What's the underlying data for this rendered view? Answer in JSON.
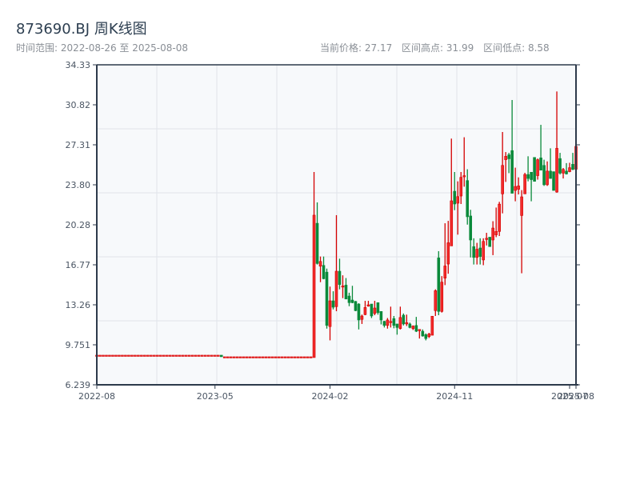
{
  "header": {
    "title": "873690.BJ 周K线图",
    "range_label": "时间范围: 2022-08-26 至 2025-08-08",
    "current_price": "当前价格: 27.17",
    "range_high": "区间高点: 31.99",
    "range_low": "区间低点: 8.58"
  },
  "colors": {
    "up": "#d40000",
    "up_fill": "#f22a2a",
    "down": "#0a8a3a",
    "axis": "#2d3a4b",
    "grid": "#e1e4ea",
    "plot_bg": "#f7f9fb"
  },
  "chart_data": {
    "type": "candlestick",
    "title": "873690.BJ 周K线图",
    "ylim": [
      6.239,
      34.33
    ],
    "yticks": [
      "6.239",
      "9.751",
      "13.26",
      "16.77",
      "20.28",
      "23.80",
      "27.31",
      "30.82",
      "34.33"
    ],
    "xticks": [
      {
        "label": "2022-08",
        "date": "2022-08-26"
      },
      {
        "label": "2023-05",
        "date": "2023-05-12"
      },
      {
        "label": "2024-02",
        "date": "2024-02-16"
      },
      {
        "label": "2024-11",
        "date": "2024-11-15"
      },
      {
        "label": "2025-07",
        "date": "2025-07-25"
      },
      {
        "label": "2025-08",
        "date": "2025-08-08"
      }
    ],
    "grid": true,
    "fields": [
      "date",
      "open",
      "close",
      "low",
      "high"
    ],
    "candles": [
      [
        "2022-08-26",
        8.84,
        8.84,
        8.84,
        8.84
      ],
      [
        "2022-09-02",
        8.84,
        8.84,
        8.84,
        8.84
      ],
      [
        "2022-09-09",
        8.84,
        8.84,
        8.84,
        8.84
      ],
      [
        "2022-09-16",
        8.84,
        8.84,
        8.84,
        8.84
      ],
      [
        "2022-09-23",
        8.84,
        8.84,
        8.84,
        8.84
      ],
      [
        "2022-09-30",
        8.84,
        8.84,
        8.84,
        8.84
      ],
      [
        "2022-10-07",
        8.84,
        8.84,
        8.84,
        8.84
      ],
      [
        "2022-10-14",
        8.84,
        8.84,
        8.84,
        8.84
      ],
      [
        "2022-10-21",
        8.84,
        8.84,
        8.84,
        8.84
      ],
      [
        "2022-10-28",
        8.84,
        8.84,
        8.84,
        8.84
      ],
      [
        "2022-11-04",
        8.84,
        8.84,
        8.84,
        8.84
      ],
      [
        "2022-11-11",
        8.84,
        8.84,
        8.84,
        8.84
      ],
      [
        "2022-11-18",
        8.84,
        8.84,
        8.84,
        8.84
      ],
      [
        "2022-11-25",
        8.84,
        8.84,
        8.84,
        8.84
      ],
      [
        "2022-12-02",
        8.84,
        8.84,
        8.84,
        8.84
      ],
      [
        "2022-12-09",
        8.84,
        8.84,
        8.84,
        8.84
      ],
      [
        "2022-12-16",
        8.84,
        8.84,
        8.84,
        8.84
      ],
      [
        "2022-12-23",
        8.84,
        8.84,
        8.84,
        8.84
      ],
      [
        "2022-12-30",
        8.84,
        8.84,
        8.84,
        8.84
      ],
      [
        "2023-01-06",
        8.84,
        8.84,
        8.84,
        8.84
      ],
      [
        "2023-01-13",
        8.84,
        8.84,
        8.84,
        8.84
      ],
      [
        "2023-01-20",
        8.84,
        8.84,
        8.84,
        8.84
      ],
      [
        "2023-01-27",
        8.84,
        8.84,
        8.84,
        8.84
      ],
      [
        "2023-02-03",
        8.84,
        8.84,
        8.84,
        8.84
      ],
      [
        "2023-02-10",
        8.84,
        8.84,
        8.84,
        8.84
      ],
      [
        "2023-02-17",
        8.84,
        8.84,
        8.84,
        8.84
      ],
      [
        "2023-02-24",
        8.84,
        8.84,
        8.84,
        8.84
      ],
      [
        "2023-03-03",
        8.84,
        8.84,
        8.84,
        8.84
      ],
      [
        "2023-03-10",
        8.84,
        8.84,
        8.84,
        8.84
      ],
      [
        "2023-03-17",
        8.84,
        8.84,
        8.84,
        8.84
      ],
      [
        "2023-03-24",
        8.84,
        8.84,
        8.84,
        8.84
      ],
      [
        "2023-03-31",
        8.84,
        8.84,
        8.84,
        8.84
      ],
      [
        "2023-04-07",
        8.84,
        8.84,
        8.84,
        8.84
      ],
      [
        "2023-04-14",
        8.84,
        8.84,
        8.84,
        8.84
      ],
      [
        "2023-04-21",
        8.84,
        8.84,
        8.84,
        8.84
      ],
      [
        "2023-04-28",
        8.84,
        8.84,
        8.84,
        8.84
      ],
      [
        "2023-05-05",
        8.84,
        8.84,
        8.84,
        8.84
      ],
      [
        "2023-05-12",
        8.84,
        8.84,
        8.84,
        8.84
      ],
      [
        "2023-05-19",
        8.84,
        8.84,
        8.84,
        8.84
      ],
      [
        "2023-05-26",
        8.84,
        8.7,
        8.7,
        8.84
      ],
      [
        "2023-06-02",
        8.7,
        8.7,
        8.7,
        8.7
      ],
      [
        "2023-06-09",
        8.7,
        8.7,
        8.7,
        8.7
      ],
      [
        "2023-06-16",
        8.7,
        8.7,
        8.7,
        8.7
      ],
      [
        "2023-06-23",
        8.7,
        8.7,
        8.7,
        8.7
      ],
      [
        "2023-06-30",
        8.7,
        8.7,
        8.7,
        8.7
      ],
      [
        "2023-07-07",
        8.7,
        8.7,
        8.7,
        8.7
      ],
      [
        "2023-07-14",
        8.7,
        8.7,
        8.7,
        8.7
      ],
      [
        "2023-07-21",
        8.7,
        8.7,
        8.7,
        8.7
      ],
      [
        "2023-07-28",
        8.7,
        8.7,
        8.7,
        8.7
      ],
      [
        "2023-08-04",
        8.7,
        8.7,
        8.7,
        8.7
      ],
      [
        "2023-08-11",
        8.7,
        8.7,
        8.7,
        8.7
      ],
      [
        "2023-08-18",
        8.7,
        8.7,
        8.7,
        8.7
      ],
      [
        "2023-08-25",
        8.7,
        8.7,
        8.7,
        8.7
      ],
      [
        "2023-09-01",
        8.7,
        8.7,
        8.7,
        8.7
      ],
      [
        "2023-09-08",
        8.7,
        8.7,
        8.7,
        8.7
      ],
      [
        "2023-09-15",
        8.7,
        8.7,
        8.7,
        8.7
      ],
      [
        "2023-09-22",
        8.7,
        8.7,
        8.7,
        8.7
      ],
      [
        "2023-09-29",
        8.7,
        8.7,
        8.7,
        8.7
      ],
      [
        "2023-10-06",
        8.7,
        8.7,
        8.7,
        8.7
      ],
      [
        "2023-10-13",
        8.7,
        8.7,
        8.7,
        8.7
      ],
      [
        "2023-10-20",
        8.7,
        8.7,
        8.7,
        8.7
      ],
      [
        "2023-10-27",
        8.7,
        8.7,
        8.7,
        8.7
      ],
      [
        "2023-11-03",
        8.7,
        8.7,
        8.7,
        8.7
      ],
      [
        "2023-11-10",
        8.7,
        8.7,
        8.7,
        8.7
      ],
      [
        "2023-11-17",
        8.7,
        8.7,
        8.7,
        8.7
      ],
      [
        "2023-11-24",
        8.7,
        8.7,
        8.7,
        8.7
      ],
      [
        "2023-12-01",
        8.7,
        8.7,
        8.7,
        8.7
      ],
      [
        "2023-12-08",
        8.7,
        8.7,
        8.7,
        8.7
      ],
      [
        "2024-01-12",
        8.63,
        21.13,
        8.63,
        24.92
      ],
      [
        "2024-01-19",
        20.42,
        16.89,
        16.8,
        22.25
      ],
      [
        "2024-01-26",
        16.65,
        17.07,
        15.25,
        17.5
      ],
      [
        "2024-02-02",
        16.72,
        15.55,
        15.5,
        17.5
      ],
      [
        "2024-02-09",
        16.13,
        11.45,
        11.17,
        16.44
      ],
      [
        "2024-02-16",
        11.35,
        13.61,
        10.14,
        14.86
      ],
      [
        "2024-02-23",
        13.61,
        13.05,
        12.86,
        14.45
      ],
      [
        "2024-03-01",
        13.1,
        16.21,
        12.7,
        21.13
      ],
      [
        "2024-03-08",
        16.21,
        15.04,
        14.62,
        17.31
      ],
      [
        "2024-03-15",
        14.85,
        14.92,
        13.85,
        15.85
      ],
      [
        "2024-03-22",
        14.99,
        13.77,
        13.75,
        15.61
      ],
      [
        "2024-03-29",
        14.03,
        13.45,
        13.14,
        14.32
      ],
      [
        "2024-04-05",
        13.68,
        13.45,
        13.4,
        14.93
      ],
      [
        "2024-04-12",
        13.56,
        12.75,
        12.7,
        13.6
      ],
      [
        "2024-04-19",
        13.33,
        11.93,
        11.1,
        13.4
      ],
      [
        "2024-04-26",
        11.98,
        12.28,
        11.58,
        12.4
      ],
      [
        "2024-05-03",
        12.4,
        13.03,
        12.35,
        13.61
      ],
      [
        "2024-05-10",
        13.14,
        13.26,
        13.1,
        13.61
      ],
      [
        "2024-05-17",
        13.33,
        12.28,
        12.1,
        13.33
      ],
      [
        "2024-05-24",
        12.5,
        12.98,
        12.35,
        13.61
      ],
      [
        "2024-05-31",
        13.45,
        12.58,
        12.4,
        13.45
      ],
      [
        "2024-06-07",
        12.68,
        11.93,
        11.54,
        12.68
      ],
      [
        "2024-06-14",
        11.81,
        11.45,
        11.27,
        11.85
      ],
      [
        "2024-06-21",
        11.45,
        11.93,
        11.17,
        12.1
      ],
      [
        "2024-06-28",
        11.7,
        11.8,
        11.27,
        13.1
      ],
      [
        "2024-07-05",
        12.05,
        11.45,
        11.2,
        12.28
      ],
      [
        "2024-07-12",
        11.58,
        11.27,
        10.64,
        11.58
      ],
      [
        "2024-07-19",
        11.17,
        12.15,
        11.1,
        13.1
      ],
      [
        "2024-07-26",
        12.35,
        11.58,
        11.45,
        12.5
      ],
      [
        "2024-08-02",
        11.58,
        11.7,
        11.4,
        12.4
      ],
      [
        "2024-08-09",
        11.58,
        11.27,
        11.2,
        11.7
      ],
      [
        "2024-08-16",
        11.17,
        11.4,
        11.05,
        11.45
      ],
      [
        "2024-08-23",
        11.45,
        10.94,
        10.87,
        12.2
      ],
      [
        "2024-08-30",
        10.98,
        11.1,
        10.3,
        11.1
      ],
      [
        "2024-09-06",
        10.94,
        10.52,
        10.47,
        11.1
      ],
      [
        "2024-09-13",
        10.64,
        10.3,
        10.14,
        10.75
      ],
      [
        "2024-09-20",
        10.47,
        10.7,
        10.35,
        10.8
      ],
      [
        "2024-09-27",
        10.59,
        12.26,
        10.59,
        12.28
      ],
      [
        "2024-10-04",
        12.75,
        14.5,
        12.28,
        14.62
      ],
      [
        "2024-10-11",
        17.38,
        12.68,
        12.35,
        17.97
      ],
      [
        "2024-10-18",
        12.68,
        15.25,
        12.58,
        15.78
      ],
      [
        "2024-10-25",
        15.6,
        16.67,
        14.99,
        20.42
      ],
      [
        "2024-11-01",
        16.84,
        18.71,
        15.99,
        20.63
      ],
      [
        "2024-11-08",
        18.43,
        22.39,
        18.43,
        27.85
      ],
      [
        "2024-11-15",
        23.23,
        22.11,
        21.57,
        24.92
      ],
      [
        "2024-11-22",
        22.18,
        22.76,
        19.42,
        24.1
      ],
      [
        "2024-11-29",
        22.81,
        24.45,
        22.11,
        24.92
      ],
      [
        "2024-12-06",
        24.5,
        24.6,
        23.63,
        27.97
      ],
      [
        "2024-12-13",
        24.17,
        20.99,
        20.3,
        25.16
      ],
      [
        "2024-12-20",
        21.06,
        18.95,
        17.42,
        21.6
      ],
      [
        "2024-12-27",
        18.37,
        17.42,
        16.8,
        19.1
      ],
      [
        "2025-01-03",
        17.42,
        18.14,
        16.8,
        18.7
      ],
      [
        "2025-01-10",
        18.25,
        17.5,
        16.8,
        19.1
      ],
      [
        "2025-01-17",
        17.2,
        18.83,
        16.74,
        19.1
      ],
      [
        "2025-01-24",
        19.0,
        19.1,
        18.47,
        19.58
      ],
      [
        "2025-01-31",
        19.2,
        18.37,
        18.37,
        19.2
      ],
      [
        "2025-02-07",
        18.95,
        20.0,
        17.62,
        20.6
      ],
      [
        "2025-02-14",
        19.4,
        19.7,
        19.2,
        21.8
      ],
      [
        "2025-02-21",
        19.7,
        22.1,
        19.3,
        22.3
      ],
      [
        "2025-02-28",
        23.0,
        25.5,
        21.29,
        28.43
      ],
      [
        "2025-03-07",
        26.0,
        26.3,
        24.05,
        26.67
      ],
      [
        "2025-03-14",
        26.43,
        26.08,
        24.82,
        26.6
      ],
      [
        "2025-03-21",
        26.8,
        23.05,
        23.05,
        31.24
      ],
      [
        "2025-03-28",
        23.3,
        23.65,
        22.35,
        25.3
      ],
      [
        "2025-04-04",
        23.4,
        23.7,
        22.95,
        24.45
      ],
      [
        "2025-04-11",
        21.1,
        22.74,
        16.03,
        23.33
      ],
      [
        "2025-04-18",
        23.0,
        24.7,
        23.0,
        24.85
      ],
      [
        "2025-04-25",
        24.7,
        24.35,
        24.1,
        26.3
      ],
      [
        "2025-05-02",
        24.9,
        24.25,
        22.35,
        24.9
      ],
      [
        "2025-05-09",
        26.2,
        24.1,
        24.1,
        26.2
      ],
      [
        "2025-05-16",
        24.6,
        26.0,
        24.25,
        26.1
      ],
      [
        "2025-05-23",
        26.16,
        25.08,
        25.08,
        29.06
      ],
      [
        "2025-05-30",
        25.5,
        23.8,
        23.7,
        26.0
      ],
      [
        "2025-06-06",
        23.8,
        25.0,
        23.7,
        25.85
      ],
      [
        "2025-06-13",
        25.0,
        24.35,
        24.35,
        27.0
      ],
      [
        "2025-06-20",
        24.95,
        23.3,
        23.3,
        24.95
      ],
      [
        "2025-06-27",
        23.16,
        27.0,
        23.1,
        31.99
      ],
      [
        "2025-07-04",
        26.1,
        24.82,
        24.7,
        26.6
      ],
      [
        "2025-07-11",
        24.82,
        25.15,
        24.35,
        25.27
      ],
      [
        "2025-07-18",
        25.0,
        24.75,
        24.7,
        25.7
      ],
      [
        "2025-07-25",
        24.95,
        25.3,
        24.9,
        25.73
      ],
      [
        "2025-08-01",
        25.6,
        25.15,
        25.08,
        26.6
      ],
      [
        "2025-08-08",
        25.16,
        27.17,
        25.1,
        27.3
      ]
    ]
  }
}
